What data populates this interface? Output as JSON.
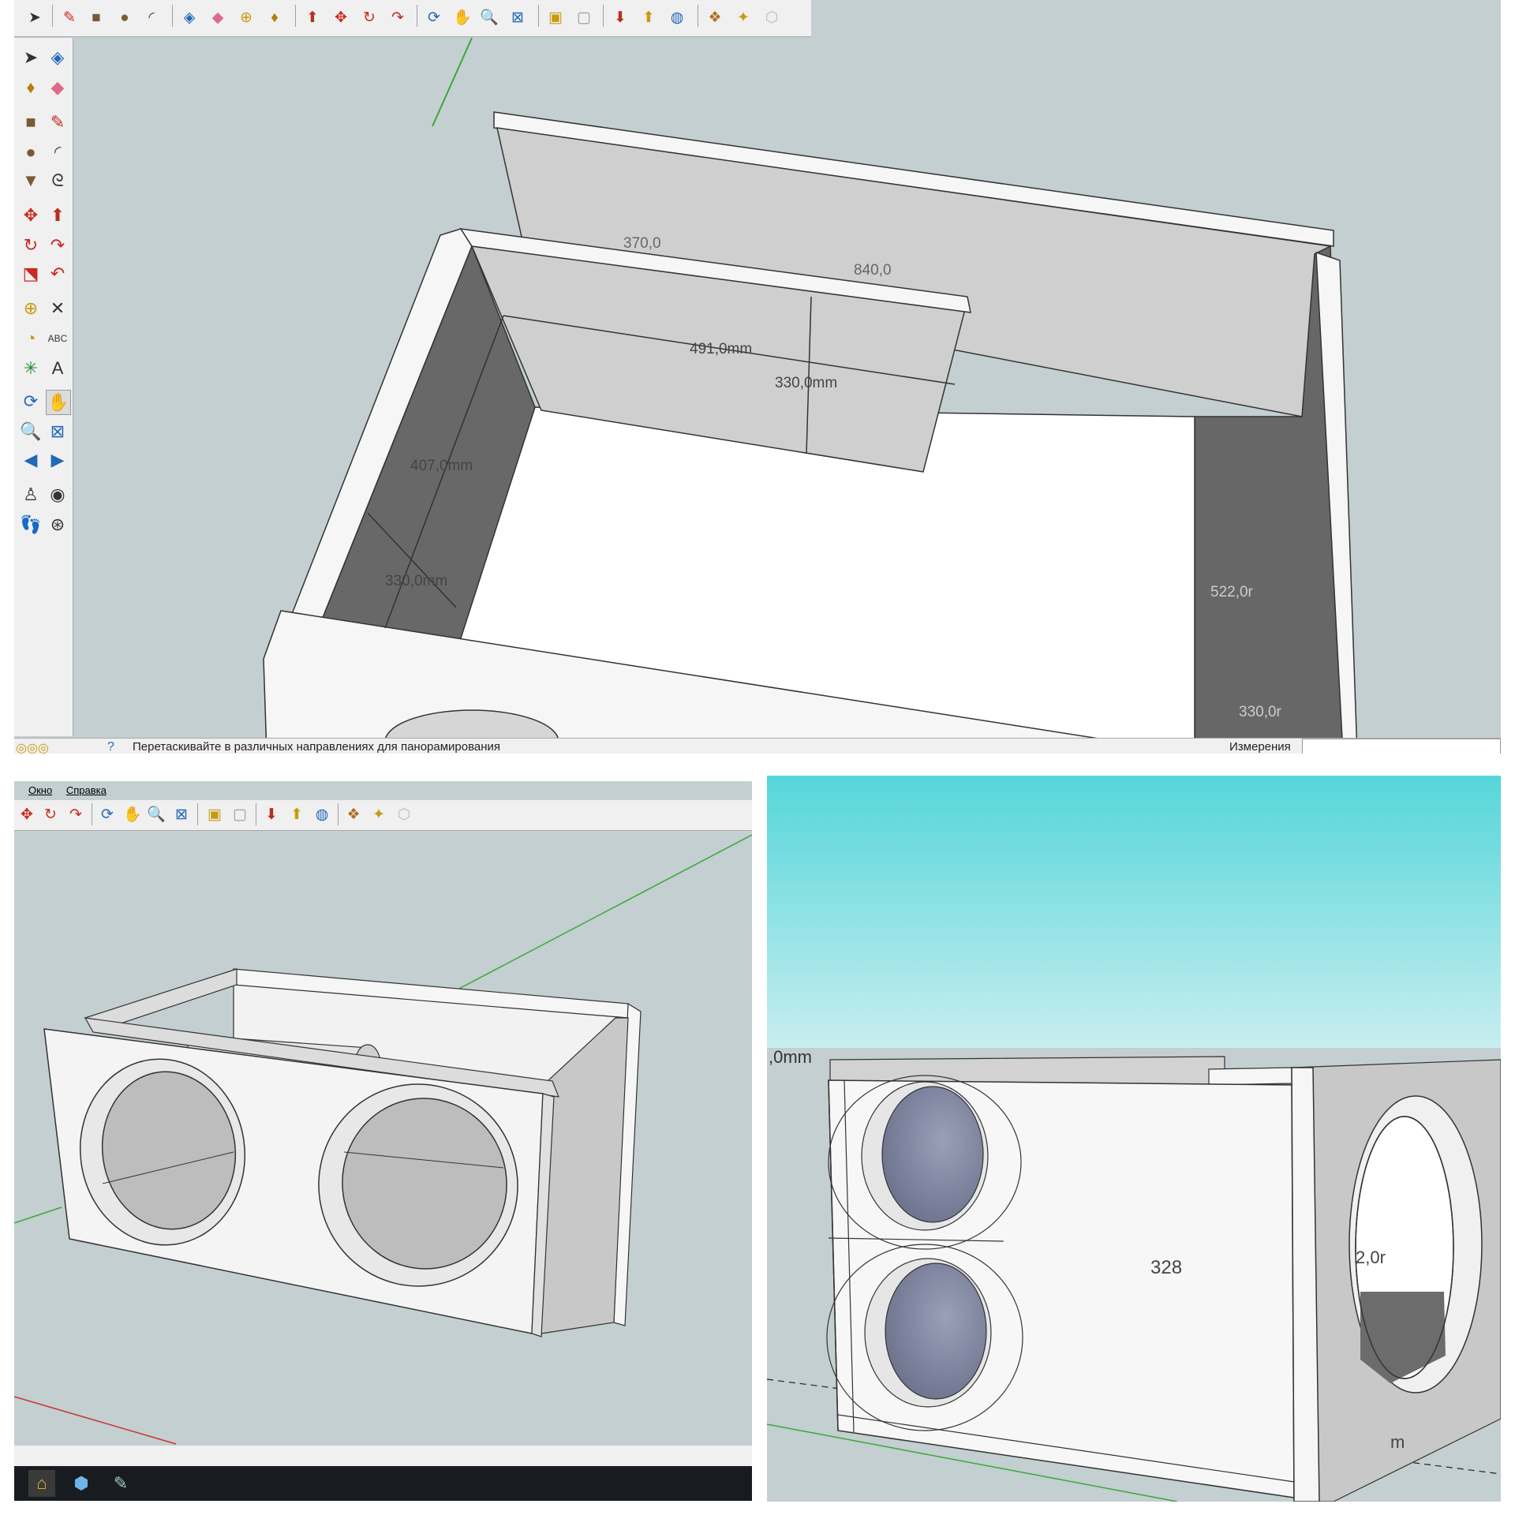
{
  "top_view": {
    "toolbar_icons": [
      "select-arrow-icon",
      "pencil-icon",
      "rectangle-icon",
      "circle-icon",
      "arc-icon",
      "make-component-icon",
      "eraser-icon",
      "tape-measure-icon",
      "paint-bucket-icon",
      "push-pull-icon",
      "move-icon",
      "rotate-icon",
      "follow-me-icon",
      "orbit-icon",
      "pan-icon",
      "zoom-icon",
      "zoom-extents-icon",
      "previous-view-icon",
      "next-view-icon",
      "get-models-icon",
      "share-model-icon",
      "google-earth-icon",
      "components-icon",
      "extension-icon",
      "styles-icon"
    ],
    "side_tools": [
      "select-arrow-icon",
      "make-component-icon",
      "paint-bucket-icon",
      "eraser-icon",
      "rectangle-icon",
      "line-icon",
      "circle-icon",
      "arc-icon",
      "polygon-icon",
      "freehand-icon",
      "move-icon",
      "push-pull-icon",
      "rotate-icon",
      "follow-me-icon",
      "scale-icon",
      "offset-icon",
      "tape-measure-icon",
      "dimension-icon",
      "protractor-icon",
      "text-icon",
      "axes-icon",
      "3d-text-icon",
      "orbit-icon",
      "pan-icon",
      "zoom-icon",
      "zoom-window-icon",
      "previous-icon",
      "next-icon",
      "position-camera-icon",
      "look-around-icon",
      "walk-icon",
      "section-plane-icon"
    ],
    "dimensions": {
      "width_491": "491,0mm",
      "height_330_center": "330,0mm",
      "depth_407": "407,0mm",
      "side_330": "330,0mm",
      "right_522": "522,0r",
      "right_330": "330,0r",
      "hidden_370": "370,0",
      "hidden_840": "840,0"
    },
    "status_hint": "Перетаскивайте в различных направлениях для панорамирования",
    "measurements_label": "Измерения",
    "measurements_value": ""
  },
  "perspective_view": {
    "menu": {
      "window": "Окно",
      "help": "Справка"
    },
    "toolbar_icons": [
      "move-icon",
      "rotate-icon",
      "follow-me-icon",
      "orbit-icon",
      "pan-icon",
      "zoom-icon",
      "zoom-extents-icon",
      "previous-view-icon",
      "next-view-icon",
      "get-models-icon",
      "share-model-icon",
      "google-earth-icon",
      "components-icon",
      "extension-icon",
      "styles-icon"
    ],
    "taskbar_icons": [
      "sketchup-icon",
      "3d-box-icon",
      "paint-icon"
    ]
  },
  "render_view": {
    "label_top_left": ",0mm",
    "label_center": "328",
    "label_right": "2,0r",
    "label_bottom": "m"
  },
  "colors": {
    "viewport_bg": "#c3cfd1",
    "sky_top": "#55d6da",
    "sky_bottom": "#c8eef0",
    "panel_dark": "#686868",
    "panel_light": "#f4f4f4",
    "axis_green": "#3aa835",
    "axis_red": "#d03030"
  }
}
